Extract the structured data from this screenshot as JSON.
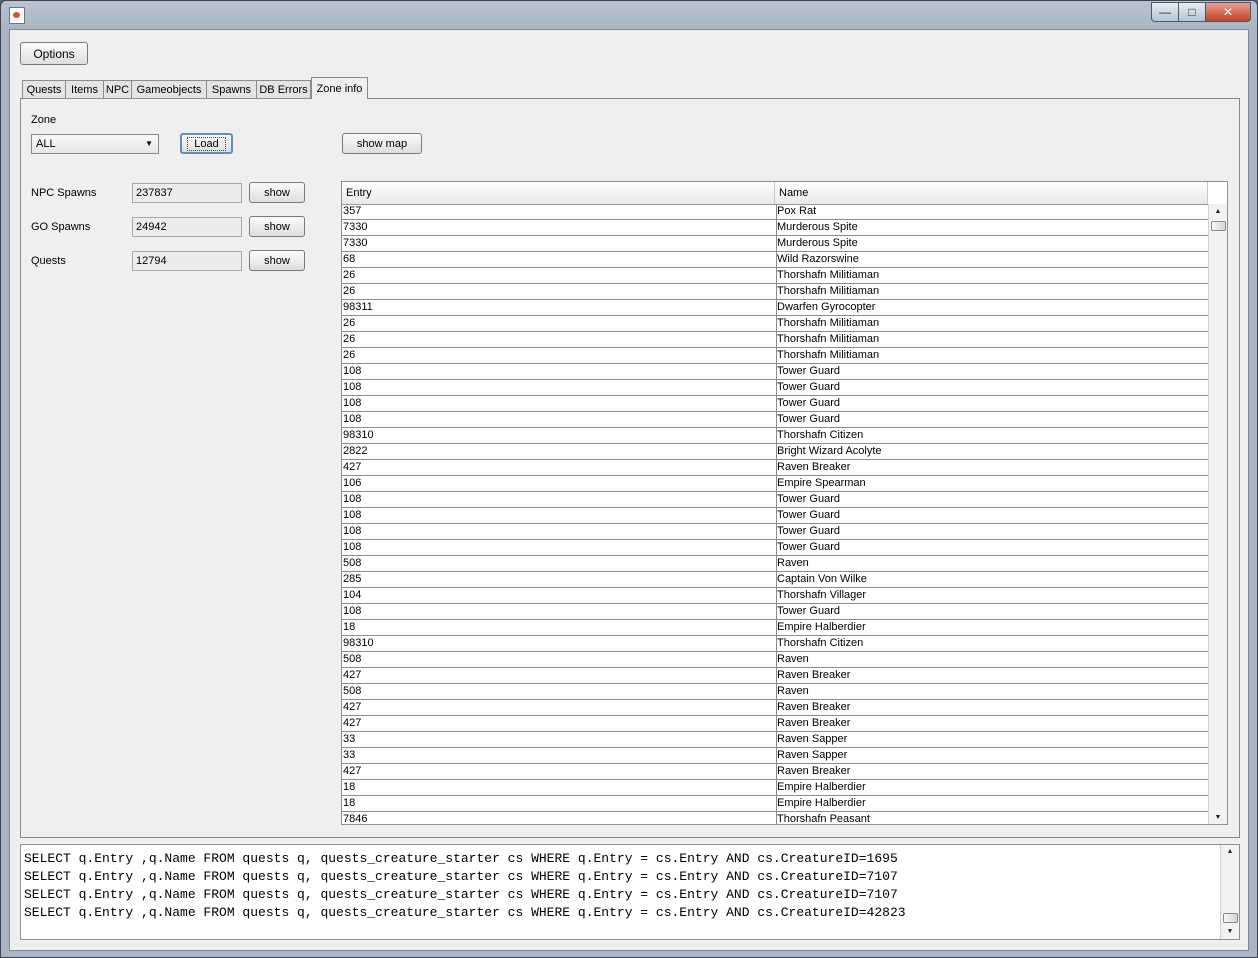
{
  "toolbar": {
    "options_label": "Options"
  },
  "tabs": [
    {
      "label": "Quests",
      "active": false
    },
    {
      "label": "Items",
      "active": false
    },
    {
      "label": "NPC",
      "active": false
    },
    {
      "label": "Gameobjects",
      "active": false
    },
    {
      "label": "Spawns",
      "active": false
    },
    {
      "label": "DB Errors",
      "active": false
    },
    {
      "label": "Zone info",
      "active": true
    }
  ],
  "zone": {
    "label": "Zone",
    "selected": "ALL",
    "load_label": "Load",
    "show_map_label": "show map"
  },
  "stats": [
    {
      "label": "NPC Spawns",
      "value": "237837",
      "button": "show"
    },
    {
      "label": "GO Spawns",
      "value": "24942",
      "button": "show"
    },
    {
      "label": "Quests",
      "value": "12794",
      "button": "show"
    }
  ],
  "table": {
    "columns": [
      "Entry",
      "Name"
    ],
    "rows": [
      [
        "357",
        "Pox Rat"
      ],
      [
        "7330",
        "Murderous Spite"
      ],
      [
        "7330",
        "Murderous Spite"
      ],
      [
        "68",
        "Wild Razorswine"
      ],
      [
        "26",
        "Thorshafn Militiaman"
      ],
      [
        "26",
        "Thorshafn Militiaman"
      ],
      [
        "98311",
        "Dwarfen Gyrocopter"
      ],
      [
        "26",
        "Thorshafn Militiaman"
      ],
      [
        "26",
        "Thorshafn Militiaman"
      ],
      [
        "26",
        "Thorshafn Militiaman"
      ],
      [
        "108",
        "Tower Guard"
      ],
      [
        "108",
        "Tower Guard"
      ],
      [
        "108",
        "Tower Guard"
      ],
      [
        "108",
        "Tower Guard"
      ],
      [
        "98310",
        "Thorshafn Citizen"
      ],
      [
        "2822",
        "Bright Wizard Acolyte"
      ],
      [
        "427",
        "Raven Breaker"
      ],
      [
        "106",
        "Empire Spearman"
      ],
      [
        "108",
        "Tower Guard"
      ],
      [
        "108",
        "Tower Guard"
      ],
      [
        "108",
        "Tower Guard"
      ],
      [
        "108",
        "Tower Guard"
      ],
      [
        "508",
        "Raven"
      ],
      [
        "285",
        "Captain Von Wilke"
      ],
      [
        "104",
        "Thorshafn Villager"
      ],
      [
        "108",
        "Tower Guard"
      ],
      [
        "18",
        "Empire Halberdier"
      ],
      [
        "98310",
        "Thorshafn Citizen"
      ],
      [
        "508",
        "Raven"
      ],
      [
        "427",
        "Raven Breaker"
      ],
      [
        "508",
        "Raven"
      ],
      [
        "427",
        "Raven Breaker"
      ],
      [
        "427",
        "Raven Breaker"
      ],
      [
        "33",
        "Raven Sapper"
      ],
      [
        "33",
        "Raven Sapper"
      ],
      [
        "427",
        "Raven Breaker"
      ],
      [
        "18",
        "Empire Halberdier"
      ],
      [
        "18",
        "Empire Halberdier"
      ],
      [
        "7846",
        "Thorshafn Peasant"
      ]
    ]
  },
  "console": {
    "lines": [
      "SELECT q.Entry ,q.Name FROM quests q, quests_creature_starter cs WHERE q.Entry = cs.Entry AND cs.CreatureID=1695",
      "SELECT q.Entry ,q.Name FROM quests q, quests_creature_starter cs WHERE q.Entry = cs.Entry AND cs.CreatureID=7107",
      "SELECT q.Entry ,q.Name FROM quests q, quests_creature_starter cs WHERE q.Entry = cs.Entry AND cs.CreatureID=7107",
      "SELECT q.Entry ,q.Name FROM quests q, quests_creature_starter cs WHERE q.Entry = cs.Entry AND cs.CreatureID=42823"
    ]
  },
  "icons": {
    "minimize": "minimize-icon",
    "maximize": "maximize-icon",
    "close": "close-icon",
    "app": "java-app-icon",
    "dropdown": "chevron-down-icon",
    "scroll_up": "scroll-up-arrow-icon",
    "scroll_down": "scroll-down-arrow-icon"
  }
}
